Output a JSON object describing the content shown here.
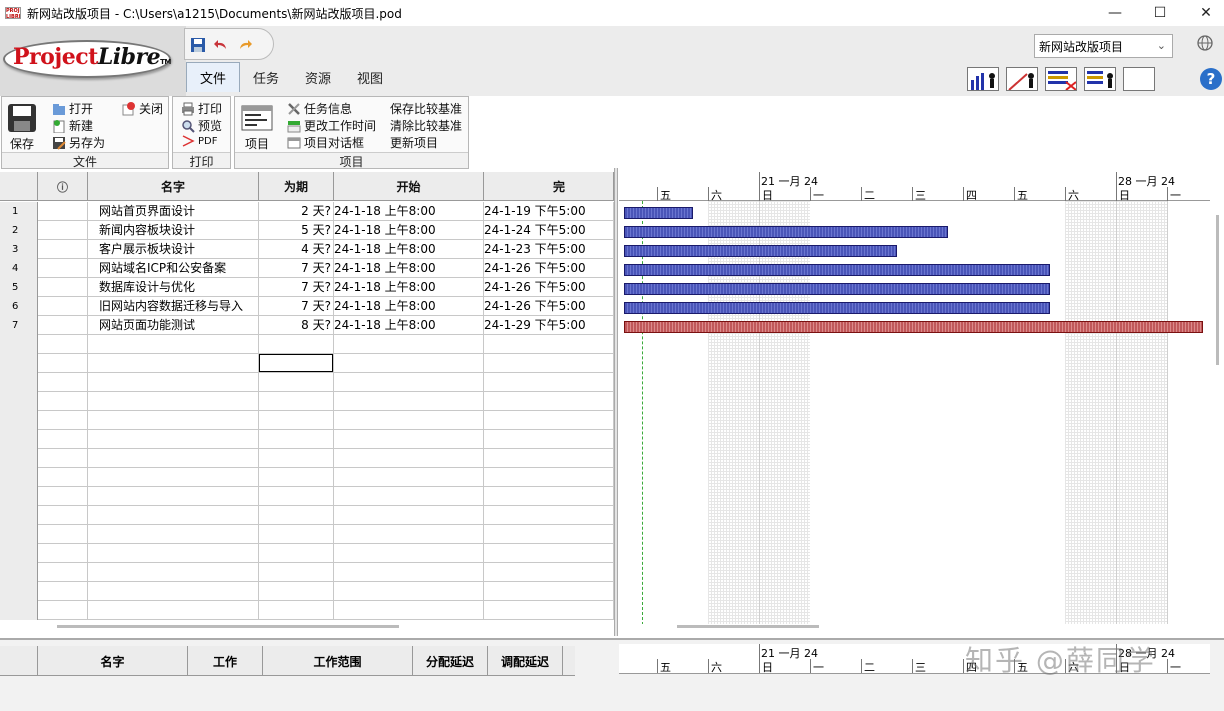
{
  "window": {
    "title": "新网站改版项目 - C:\\Users\\a1215\\Documents\\新网站改版项目.pod",
    "icon_text": "PROJECT LIBRE",
    "controls": [
      "—",
      "☐",
      "✕"
    ]
  },
  "logo": {
    "main": "Project",
    "accent": "Libre",
    "tm": "TM"
  },
  "menu": {
    "tabs": [
      "文件",
      "任务",
      "资源",
      "视图"
    ],
    "active": "文件"
  },
  "project_selector": {
    "value": "新网站改版项目"
  },
  "ribbon": {
    "file_group": {
      "label": "文件",
      "save": "保存",
      "open": "打开",
      "new": "新建",
      "save_as": "另存为",
      "close": "关闭"
    },
    "print_group": {
      "label": "打印",
      "print": "打印",
      "preview": "预览",
      "pdf": "PDF"
    },
    "project_group": {
      "label": "项目",
      "project": "项目",
      "task_info": "任务信息",
      "change_work_time": "更改工作时间",
      "project_dialog": "项目对话框",
      "save_baseline": "保存比较基准",
      "clear_baseline": "清除比较基准",
      "update_project": "更新项目"
    }
  },
  "table": {
    "columns": [
      "",
      "ⓘ",
      "名字",
      "为期",
      "开始",
      "完"
    ],
    "rows": [
      {
        "id": "1",
        "name": "网站首页界面设计",
        "duration": "2 天?",
        "start": "24-1-18  上午8:00",
        "finish": "24-1-19  下午5:00"
      },
      {
        "id": "2",
        "name": "新闻内容板块设计",
        "duration": "5 天?",
        "start": "24-1-18  上午8:00",
        "finish": "24-1-24  下午5:00"
      },
      {
        "id": "3",
        "name": "客户展示板块设计",
        "duration": "4 天?",
        "start": "24-1-18  上午8:00",
        "finish": "24-1-23  下午5:00"
      },
      {
        "id": "4",
        "name": "网站域名ICP和公安备案",
        "duration": "7 天?",
        "start": "24-1-18  上午8:00",
        "finish": "24-1-26  下午5:00"
      },
      {
        "id": "5",
        "name": "数据库设计与优化",
        "duration": "7 天?",
        "start": "24-1-18  上午8:00",
        "finish": "24-1-26  下午5:00"
      },
      {
        "id": "6",
        "name": "旧网站内容数据迁移与导入",
        "duration": "7 天?",
        "start": "24-1-18  上午8:00",
        "finish": "24-1-26  下午5:00"
      },
      {
        "id": "7",
        "name": "网站页面功能测试",
        "duration": "8 天?",
        "start": "24-1-18  上午8:00",
        "finish": "24-1-29  下午5:00"
      }
    ]
  },
  "gantt": {
    "weeks": [
      "21 一月 24",
      "28 一月 24"
    ],
    "days": [
      "五",
      "六",
      "日",
      "一",
      "二",
      "三",
      "四",
      "五",
      "六",
      "日",
      "一"
    ],
    "tasks": [
      {
        "id": 1,
        "duration_days": 2,
        "critical": false
      },
      {
        "id": 2,
        "duration_days": 5,
        "critical": false
      },
      {
        "id": 3,
        "duration_days": 4,
        "critical": false
      },
      {
        "id": 4,
        "duration_days": 7,
        "critical": false
      },
      {
        "id": 5,
        "duration_days": 7,
        "critical": false
      },
      {
        "id": 6,
        "duration_days": 7,
        "critical": false
      },
      {
        "id": 7,
        "duration_days": 8,
        "critical": true
      }
    ],
    "colors": {
      "bar": "#4a55b8",
      "critical": "#c0585a",
      "today": "#3aaa3a"
    }
  },
  "bottom_panel": {
    "columns": [
      "名字",
      "工作",
      "工作范围",
      "分配延迟",
      "调配延迟"
    ],
    "weeks": [
      "21 一月 24",
      "28 一月 24"
    ],
    "days": [
      "五",
      "六",
      "日",
      "一",
      "二",
      "三",
      "四",
      "五",
      "六",
      "日",
      "一"
    ]
  },
  "watermark": "知乎 @薛同学"
}
